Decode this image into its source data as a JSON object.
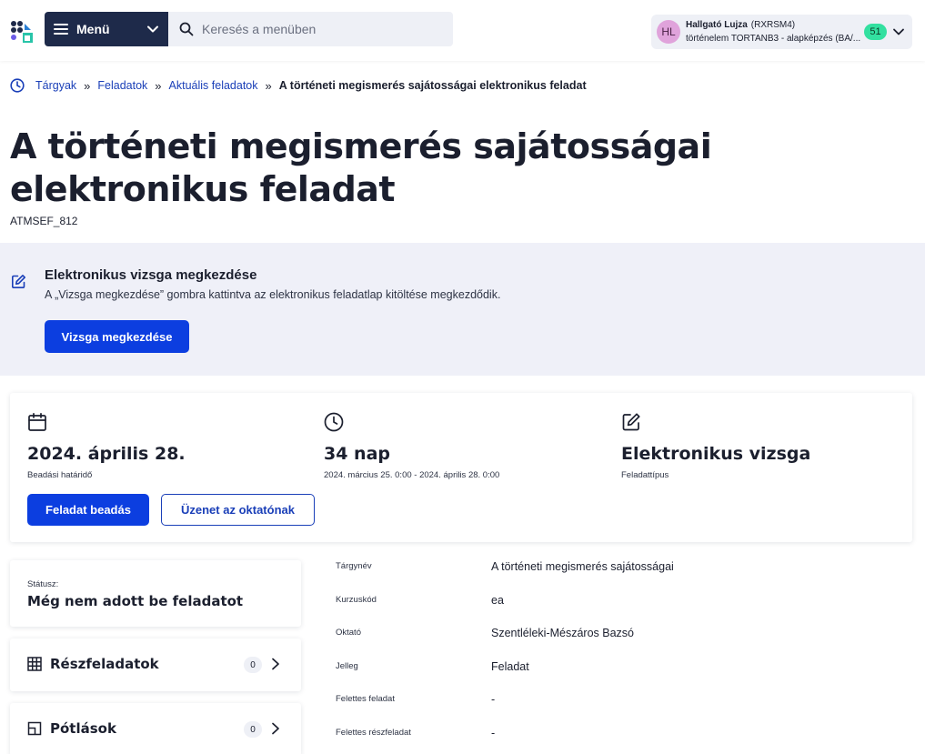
{
  "header": {
    "menu_label": "Menü",
    "search_placeholder": "Keresés a menüben",
    "user": {
      "initials": "HL",
      "name": "Hallgató Lujza",
      "code": "(RXRSM4)",
      "program": "történelem TORTANB3 - alapképzés (BA/...",
      "notifications": "51",
      "avatar_color": "#e0a3db",
      "badge_color": "#33e0a0"
    }
  },
  "breadcrumb": {
    "items": [
      "Tárgyak",
      "Feladatok",
      "Aktuális feladatok"
    ],
    "current": "A történeti megismerés sajátosságai elektronikus feladat",
    "separator": "»"
  },
  "page": {
    "title": "A történeti megismerés sajátosságai elektronikus feladat",
    "code": "ATMSEF_812"
  },
  "exam_banner": {
    "title": "Elektronikus vizsga megkezdése",
    "description": "A „Vizsga megkezdése” gombra kattintva az elektronikus feladatlap kitöltése megkezdődik.",
    "button": "Vizsga megkezdése"
  },
  "info": {
    "deadline": {
      "value": "2024. április 28.",
      "label": "Beadási határidő"
    },
    "duration": {
      "value": "34 nap",
      "label": "2024. március 25. 0:00 - 2024. április 28. 0:00"
    },
    "type": {
      "value": "Elektronikus vizsga",
      "label": "Feladattípus"
    },
    "submit_button": "Feladat beadás",
    "message_button": "Üzenet az oktatónak"
  },
  "status": {
    "label": "Státusz:",
    "value": "Még nem adott be feladatot"
  },
  "sections": [
    {
      "label": "Részfeladatok",
      "count": "0"
    },
    {
      "label": "Pótlások",
      "count": "0"
    }
  ],
  "details": [
    {
      "key": "Tárgynév",
      "value": "A történeti megismerés sajátosságai"
    },
    {
      "key": "Kurzuskód",
      "value": "ea"
    },
    {
      "key": "Oktató",
      "value": "Szentléleki-Mészáros Bazsó"
    },
    {
      "key": "Jelleg",
      "value": "Feladat"
    },
    {
      "key": "Felettes feladat",
      "value": "-"
    },
    {
      "key": "Felettes részfeladat",
      "value": "-"
    }
  ],
  "colors": {
    "primary": "#0c3ee0",
    "link": "#1a3fb8",
    "menu_bg": "#1e2a4a",
    "banner_bg": "#eff0f8"
  }
}
